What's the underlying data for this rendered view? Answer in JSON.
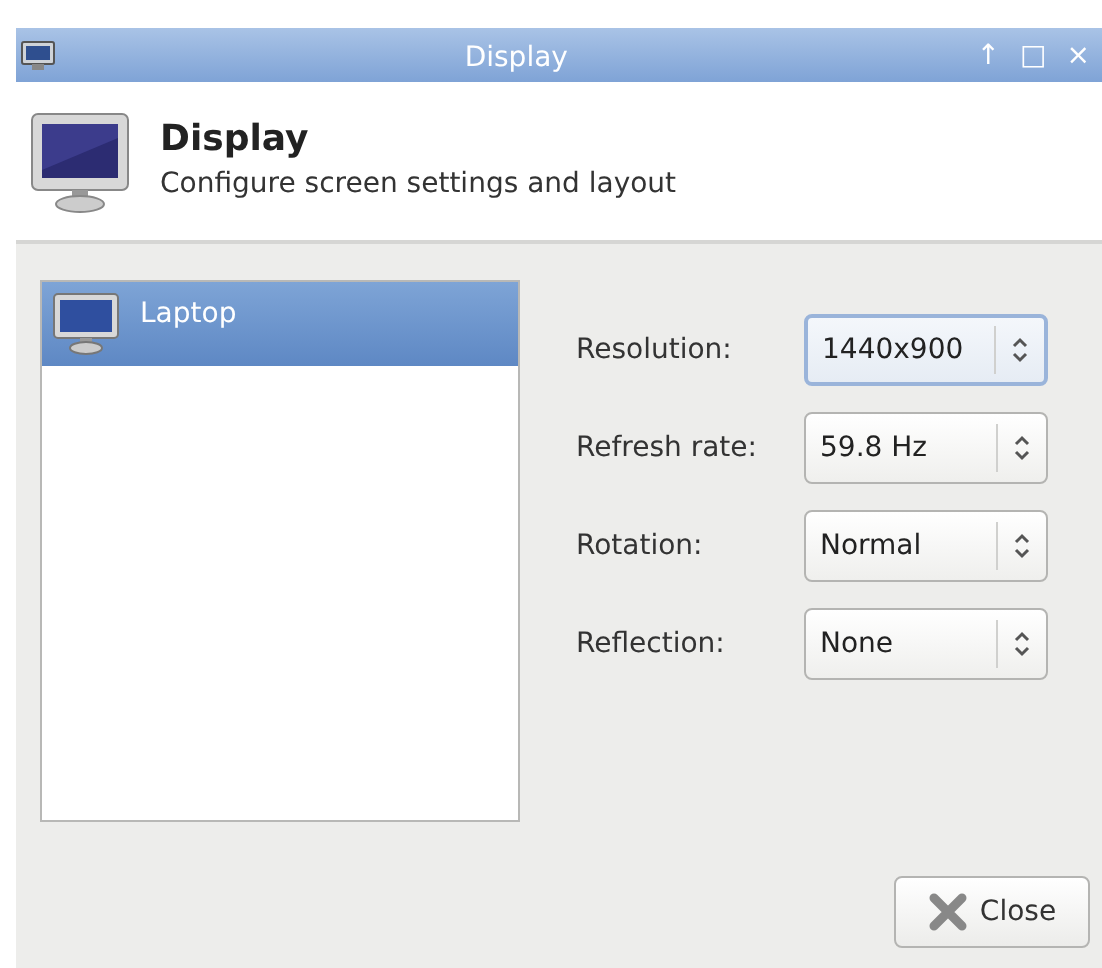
{
  "window": {
    "title": "Display",
    "controls": [
      "↑",
      "□",
      "×"
    ]
  },
  "header": {
    "title": "Display",
    "subtitle": "Configure screen settings and layout"
  },
  "outputs": [
    {
      "label": "Laptop",
      "selected": true
    }
  ],
  "settings": [
    {
      "label": "Resolution:",
      "value": "1440x900",
      "focused": true
    },
    {
      "label": "Refresh rate:",
      "value": "59.8 Hz",
      "focused": false
    },
    {
      "label": "Rotation:",
      "value": "Normal",
      "focused": false
    },
    {
      "label": "Reflection:",
      "value": "None",
      "focused": false
    }
  ],
  "buttons": [
    {
      "label": "Close"
    }
  ]
}
